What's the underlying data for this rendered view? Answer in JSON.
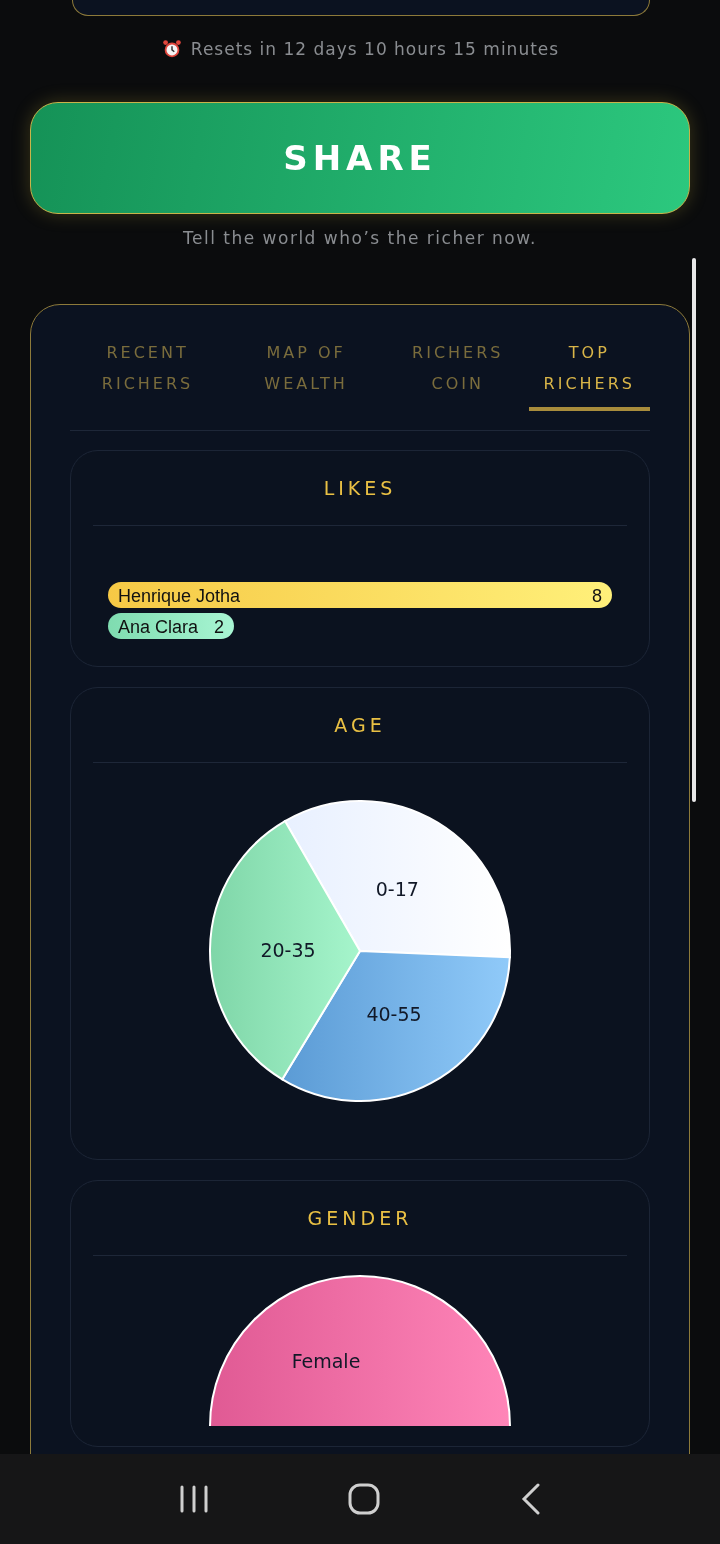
{
  "reset_note": "Resets in 12 days 10 hours 15 minutes",
  "share_button": "SHARE",
  "share_caption": "Tell the world who’s the richer now.",
  "tabs": [
    {
      "label": "RECENT RICHERS",
      "selected": false
    },
    {
      "label": "MAP OF WEALTH",
      "selected": false
    },
    {
      "label": "RICHERS COIN",
      "selected": false
    },
    {
      "label": "TOP RICHERS",
      "selected": true
    }
  ],
  "cards": [
    {
      "title": "LIKES",
      "chart_data": {
        "type": "bar",
        "orientation": "horizontal",
        "categories": [
          "Henrique Jotha",
          "Ana Clara"
        ],
        "values": [
          8,
          2
        ],
        "data_labels": true
      }
    },
    {
      "title": "AGE",
      "chart_data": {
        "type": "pie",
        "categories": [
          "0-17",
          "40-55",
          "20-35"
        ],
        "values": [
          34,
          33,
          33
        ]
      }
    },
    {
      "title": "GENDER",
      "chart_data": {
        "type": "pie",
        "categories": [
          "Female"
        ],
        "values": [
          100
        ]
      }
    }
  ]
}
